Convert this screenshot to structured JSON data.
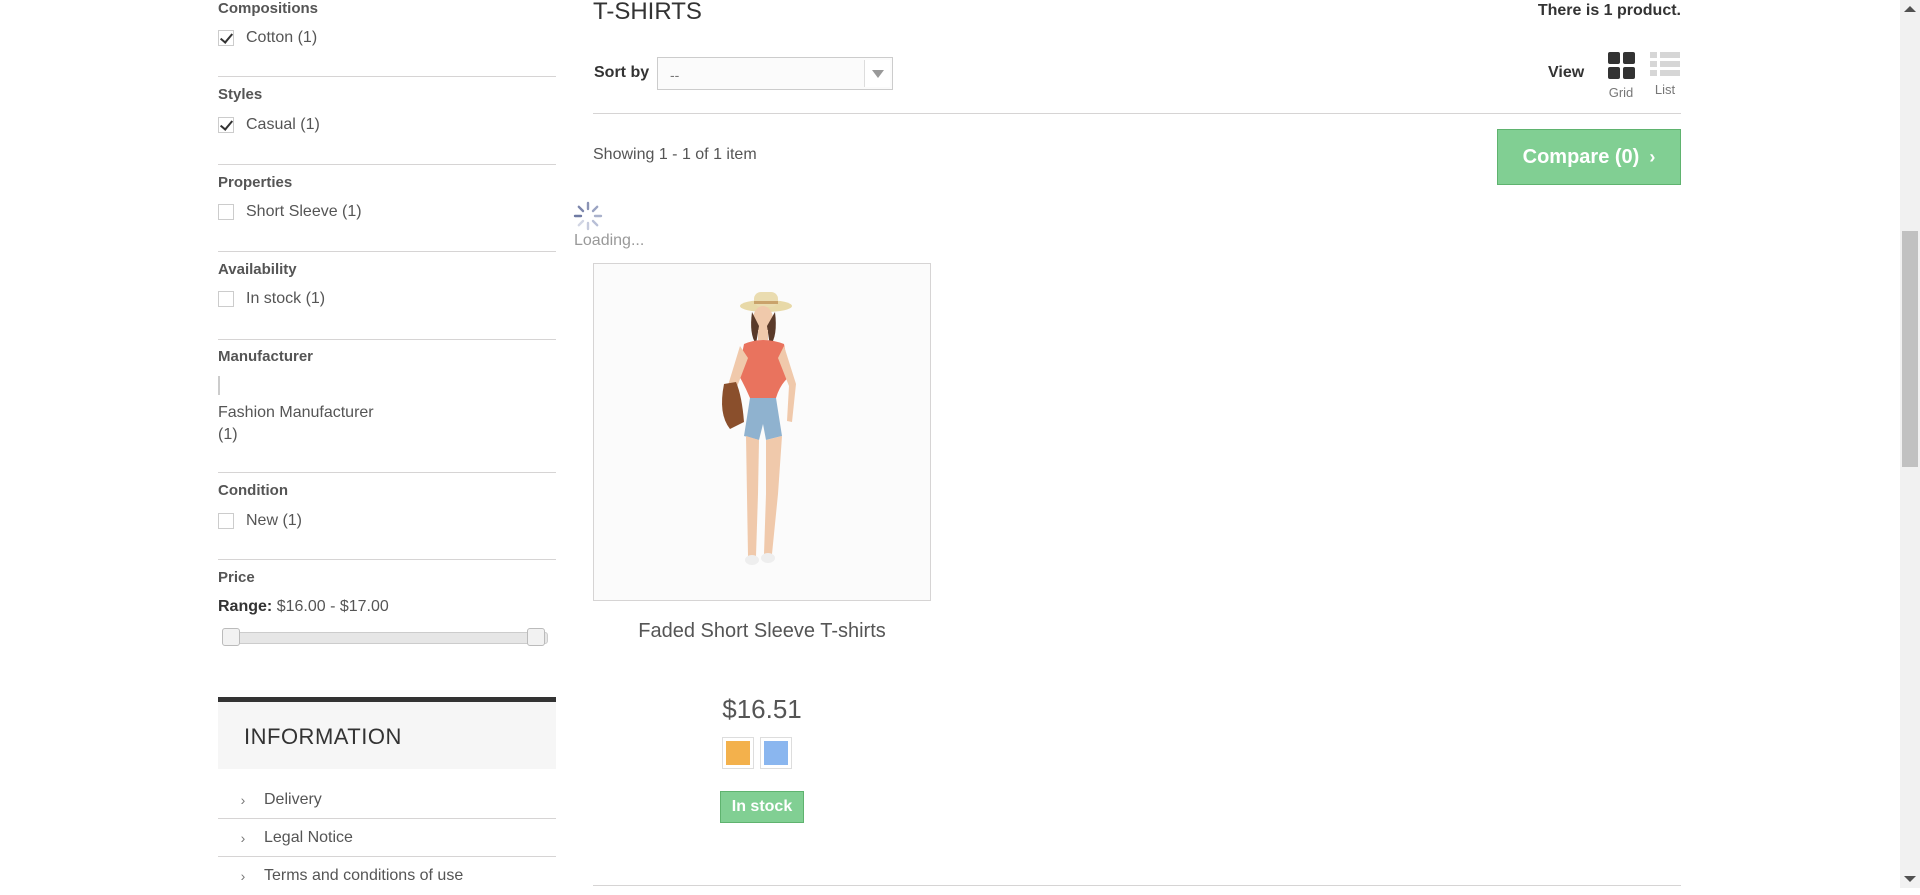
{
  "filters": {
    "compositions": {
      "title": "Compositions",
      "options": [
        {
          "label": "Cotton (1)",
          "checked": true
        }
      ]
    },
    "styles": {
      "title": "Styles",
      "options": [
        {
          "label": "Casual (1)",
          "checked": true
        }
      ]
    },
    "properties": {
      "title": "Properties",
      "options": [
        {
          "label": "Short Sleeve (1)",
          "checked": false
        }
      ]
    },
    "availability": {
      "title": "Availability",
      "options": [
        {
          "label": "In stock (1)",
          "checked": false
        }
      ]
    },
    "manufacturer": {
      "title": "Manufacturer",
      "options": [
        {
          "label_line1": "Fashion Manufacturer",
          "label_line2": "(1)",
          "checked": false
        }
      ]
    },
    "condition": {
      "title": "Condition",
      "options": [
        {
          "label": "New (1)",
          "checked": false
        }
      ]
    },
    "price": {
      "title": "Price",
      "range_label": "Range:",
      "range_value": "$16.00 - $17.00",
      "min": 16.0,
      "max": 17.0,
      "selected_min": 16.0,
      "selected_max": 17.0
    }
  },
  "information": {
    "title": "INFORMATION",
    "links": [
      "Delivery",
      "Legal Notice",
      "Terms and conditions of use"
    ],
    "chevron": "›"
  },
  "category": {
    "title": "T-SHIRTS",
    "product_count": "There is 1 product."
  },
  "toolbar": {
    "sort_label": "Sort by",
    "sort_value": "--",
    "view_label": "View",
    "grid_label": "Grid",
    "list_label": "List",
    "view_mode": "grid"
  },
  "listing": {
    "showing": "Showing 1 - 1 of 1 item",
    "compare_label": "Compare (0)",
    "compare_chevron": "›",
    "loading": "Loading..."
  },
  "product": {
    "name": "Faded Short Sleeve T-shirts",
    "price": "$16.51",
    "availability": "In stock",
    "swatches": [
      "#f3b14c",
      "#8ab6ef"
    ]
  },
  "colors": {
    "accent_green": "#81cf93",
    "text_dark": "#333333",
    "separator": "#d6d4d4"
  }
}
